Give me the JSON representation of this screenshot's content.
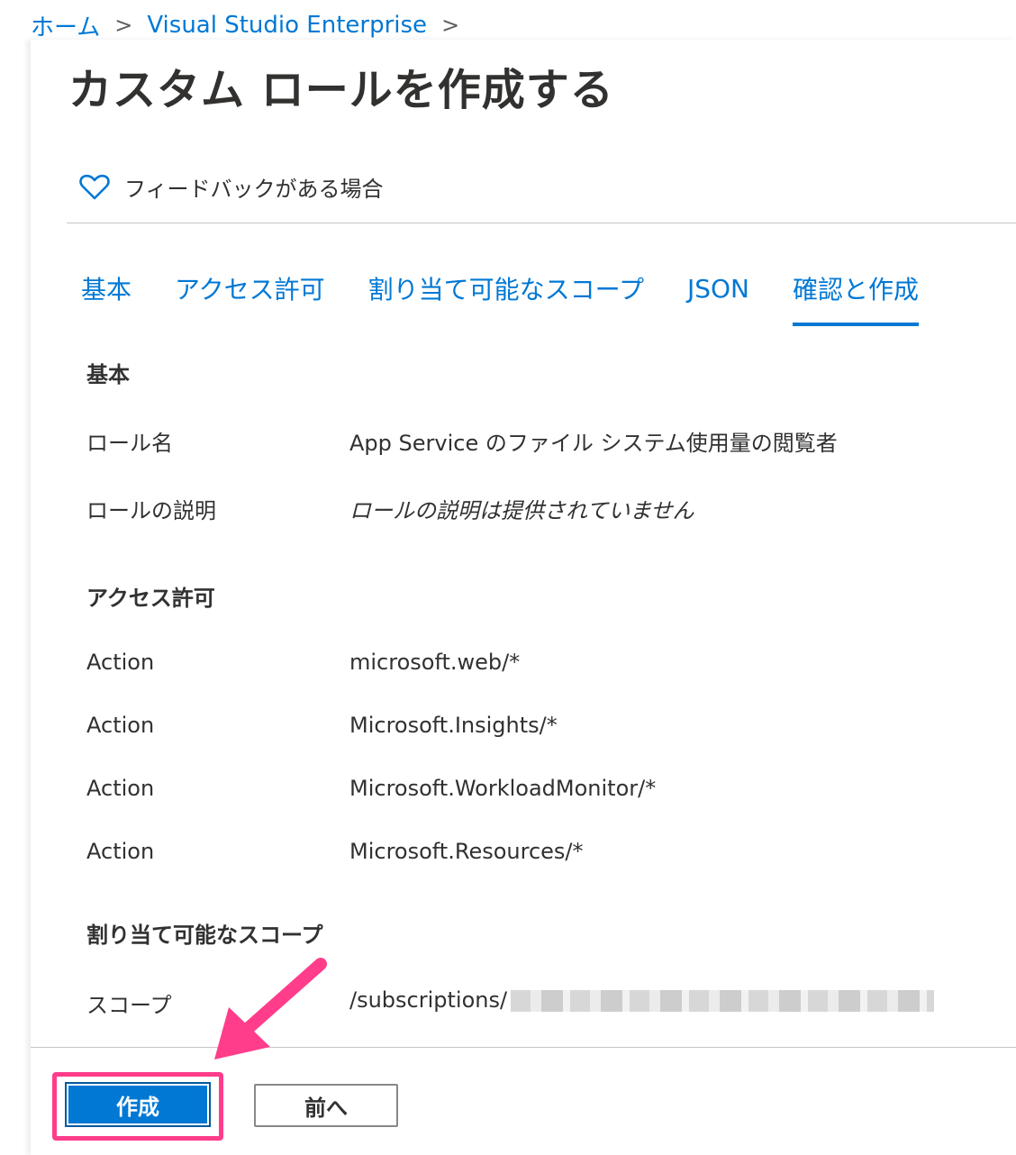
{
  "breadcrumb": {
    "items": [
      "ホーム",
      "Visual Studio Enterprise"
    ],
    "separator": ">"
  },
  "page_title": "カスタム ロールを作成する",
  "feedback": {
    "label": "フィードバックがある場合",
    "icon": "heart-icon"
  },
  "tabs": [
    {
      "label": "基本",
      "active": false
    },
    {
      "label": "アクセス許可",
      "active": false
    },
    {
      "label": "割り当て可能なスコープ",
      "active": false
    },
    {
      "label": "JSON",
      "active": false
    },
    {
      "label": "確認と作成",
      "active": true
    }
  ],
  "review": {
    "basics": {
      "title": "基本",
      "role_name_label": "ロール名",
      "role_name_value": "App Service のファイル システム使用量の閲覧者",
      "description_label": "ロールの説明",
      "description_value": "ロールの説明は提供されていません"
    },
    "permissions": {
      "title": "アクセス許可",
      "rows": [
        {
          "label": "Action",
          "value": "microsoft.web/*"
        },
        {
          "label": "Action",
          "value": "Microsoft.Insights/*"
        },
        {
          "label": "Action",
          "value": "Microsoft.WorkloadMonitor/*"
        },
        {
          "label": "Action",
          "value": "Microsoft.Resources/*"
        }
      ]
    },
    "scopes": {
      "title": "割り当て可能なスコープ",
      "label": "スコープ",
      "value": "/subscriptions/"
    }
  },
  "footer": {
    "create_label": "作成",
    "back_label": "前へ"
  },
  "colors": {
    "accent": "#0078d4",
    "annotation": "#ff3d8b"
  }
}
